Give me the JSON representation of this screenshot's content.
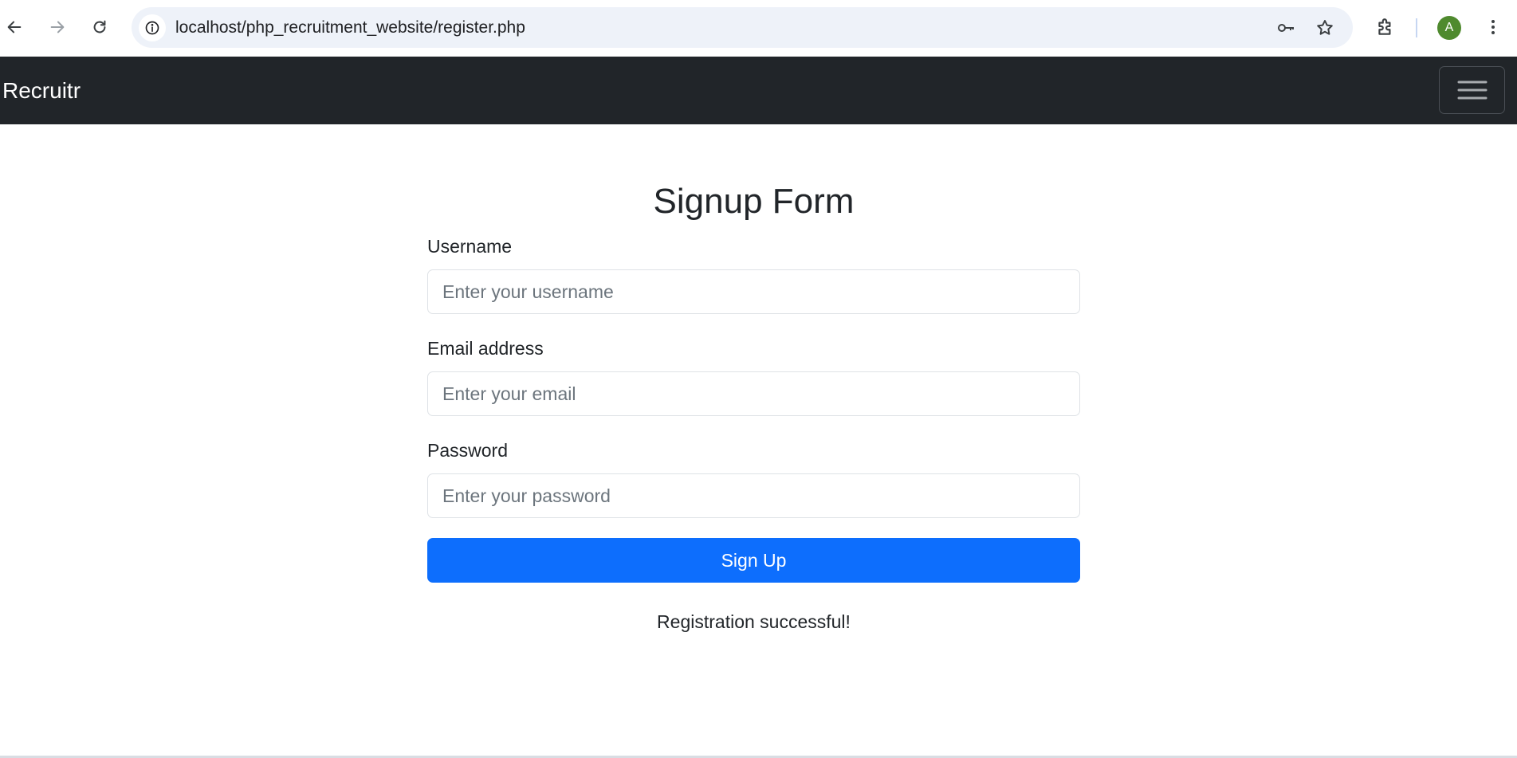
{
  "browser": {
    "url": "localhost/php_recruitment_website/register.php",
    "profile_initial": "A",
    "icons": {
      "back": "arrow-left-icon",
      "forward": "arrow-right-icon",
      "reload": "reload-icon",
      "site_info": "info-icon",
      "password": "key-icon",
      "bookmark": "star-icon",
      "extensions": "puzzle-icon",
      "menu": "kebab-menu-icon"
    }
  },
  "navbar": {
    "brand": "Recruitr",
    "toggler_icon": "hamburger-icon",
    "background": "#212529"
  },
  "form": {
    "title": "Signup Form",
    "fields": [
      {
        "label": "Username",
        "value": "",
        "placeholder": "Enter your username"
      },
      {
        "label": "Email address",
        "value": "",
        "placeholder": "Enter your email"
      },
      {
        "label": "Password",
        "value": "",
        "placeholder": "Enter your password"
      }
    ],
    "submit_label": "Sign Up",
    "submit_color": "#0d6efd",
    "status_message": "Registration successful!"
  }
}
